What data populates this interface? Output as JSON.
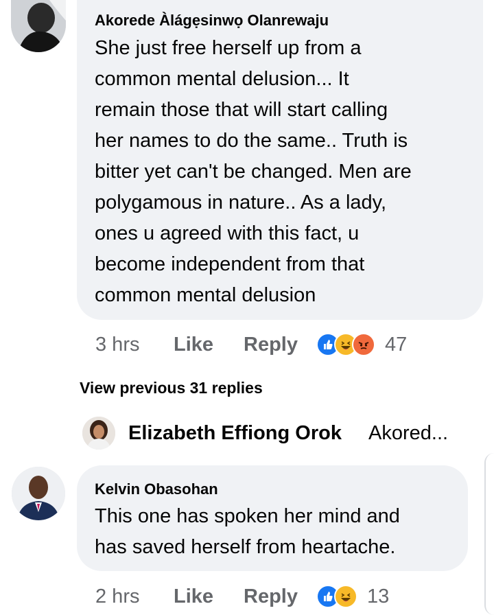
{
  "comments": [
    {
      "author": "Akorede Àlágẹsinwọ Olanrewaju",
      "lines": [
        "She just free herself up from a",
        "common mental delusion... It",
        "remain those that will start calling",
        "her names to do the same.. Truth is",
        "bitter yet can't be changed. Men are",
        "polygamous in nature.. As a lady,",
        "ones u agreed with this fact, u",
        "become independent from that",
        "common mental delusion"
      ],
      "time": "3 hrs",
      "like_label": "Like",
      "reply_label": "Reply",
      "reaction_count": "47"
    },
    {
      "author": "Kelvin Obasohan",
      "lines": [
        "This one has spoken her mind and",
        "has saved herself from heartache."
      ],
      "time": "2 hrs",
      "like_label": "Like",
      "reply_label": "Reply",
      "reaction_count": "13"
    }
  ],
  "view_previous": "View previous 31 replies",
  "collapsed_reply": {
    "author": "Elizabeth Effiong Orok",
    "snippet": "Akored..."
  },
  "colors": {
    "bubble": "#f0f2f5",
    "meta_text": "#65676b",
    "like_blue": "#1877f2",
    "haha_yellow": "#f7b928",
    "angry_orange": "#f0693c"
  }
}
